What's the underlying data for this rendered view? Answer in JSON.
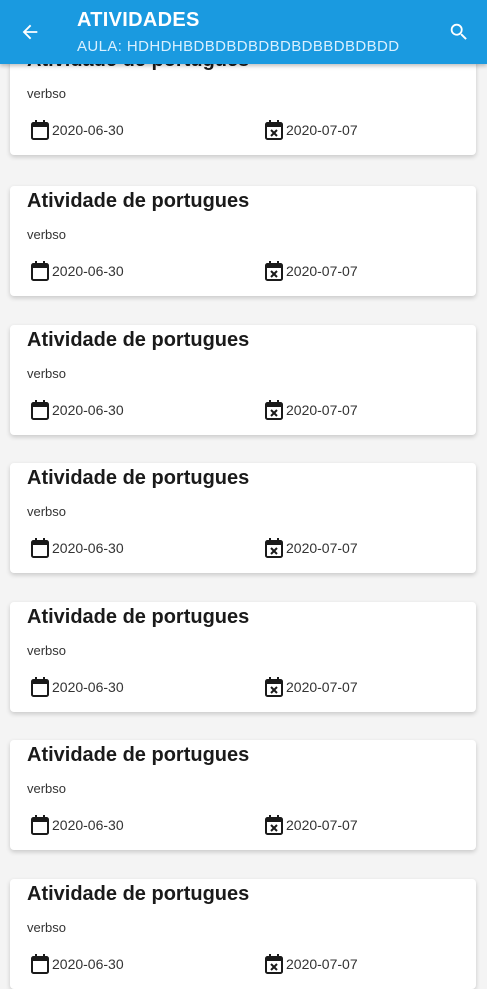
{
  "header": {
    "title": "ATIVIDADES",
    "subtitle": "AULA: HDHDHBDBDBDBDBDBDBBDBDBDD",
    "back_icon": "arrow-back-icon",
    "search_icon": "search-icon",
    "color": "#1a9ae0"
  },
  "activities": [
    {
      "title": "Atividade de portugues",
      "description": "verbso",
      "start_date": "2020-06-30",
      "end_date": "2020-07-07"
    },
    {
      "title": "Atividade de portugues",
      "description": "verbso",
      "start_date": "2020-06-30",
      "end_date": "2020-07-07"
    },
    {
      "title": "Atividade de portugues",
      "description": "verbso",
      "start_date": "2020-06-30",
      "end_date": "2020-07-07"
    },
    {
      "title": "Atividade de portugues",
      "description": "verbso",
      "start_date": "2020-06-30",
      "end_date": "2020-07-07"
    },
    {
      "title": "Atividade de portugues",
      "description": "verbso",
      "start_date": "2020-06-30",
      "end_date": "2020-07-07"
    },
    {
      "title": "Atividade de portugues",
      "description": "verbso",
      "start_date": "2020-06-30",
      "end_date": "2020-07-07"
    },
    {
      "title": "Atividade de portugues",
      "description": "verbso",
      "start_date": "2020-06-30",
      "end_date": "2020-07-07"
    }
  ]
}
